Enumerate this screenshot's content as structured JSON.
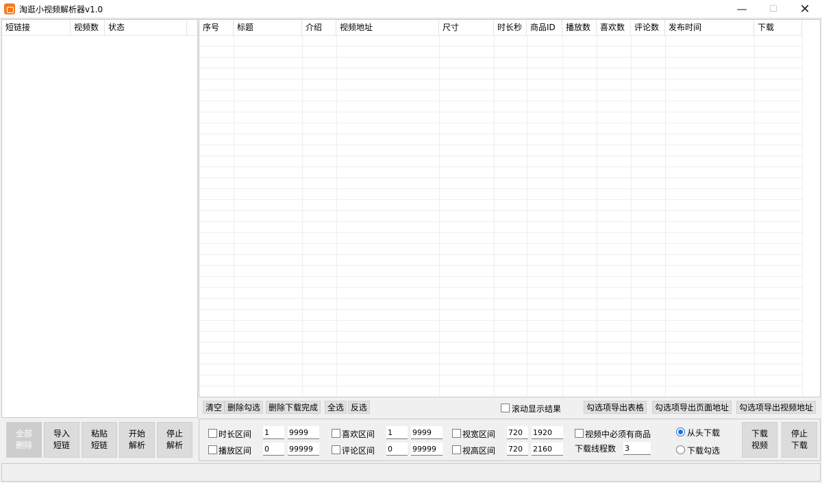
{
  "window": {
    "title": "淘逛小视频解析器v1.0",
    "minimize": "—",
    "maximize": "☐",
    "close": "✕"
  },
  "left_list": {
    "columns": [
      "短链接",
      "视频数",
      "状态"
    ]
  },
  "result_table": {
    "columns": [
      "序号",
      "标题",
      "介绍",
      "视频地址",
      "尺寸",
      "时长秒",
      "商品ID",
      "播放数",
      "喜欢数",
      "评论数",
      "发布时间",
      "下载"
    ],
    "rows": []
  },
  "toolbar": {
    "clear": "清空",
    "delete_checked": "删除勾选",
    "delete_downloaded": "删除下载完成",
    "select_all": "全选",
    "invert_select": "反选",
    "scroll_show_results": "滚动显示结果",
    "export_table": "勾选项导出表格",
    "export_page_url": "勾选项导出页面地址",
    "export_video_url": "勾选项导出视频地址"
  },
  "left_buttons": {
    "delete_all": [
      "全部",
      "删除"
    ],
    "import_links": [
      "导入",
      "短链"
    ],
    "paste_links": [
      "粘贴",
      "短链"
    ],
    "start_parse": [
      "开始",
      "解析"
    ],
    "stop_parse": [
      "停止",
      "解析"
    ]
  },
  "filters": {
    "duration": {
      "label": "时长区间",
      "min": "1",
      "max": "9999"
    },
    "plays": {
      "label": "播放区间",
      "min": "0",
      "max": "99999"
    },
    "likes": {
      "label": "喜欢区间",
      "min": "1",
      "max": "9999"
    },
    "comments": {
      "label": "评论区间",
      "min": "0",
      "max": "99999"
    },
    "width": {
      "label": "视宽区间",
      "min": "720",
      "max": "1920"
    },
    "height": {
      "label": "视高区间",
      "min": "720",
      "max": "2160"
    },
    "must_have_product": "视频中必须有商品",
    "threads_label": "下载线程数",
    "threads_value": "3"
  },
  "download_mode": {
    "from_start": "从头下载",
    "download_checked": "下载勾选",
    "selected": "from_start"
  },
  "download_buttons": {
    "download_video": [
      "下载",
      "视频"
    ],
    "stop_download": [
      "停止",
      "下载"
    ]
  }
}
